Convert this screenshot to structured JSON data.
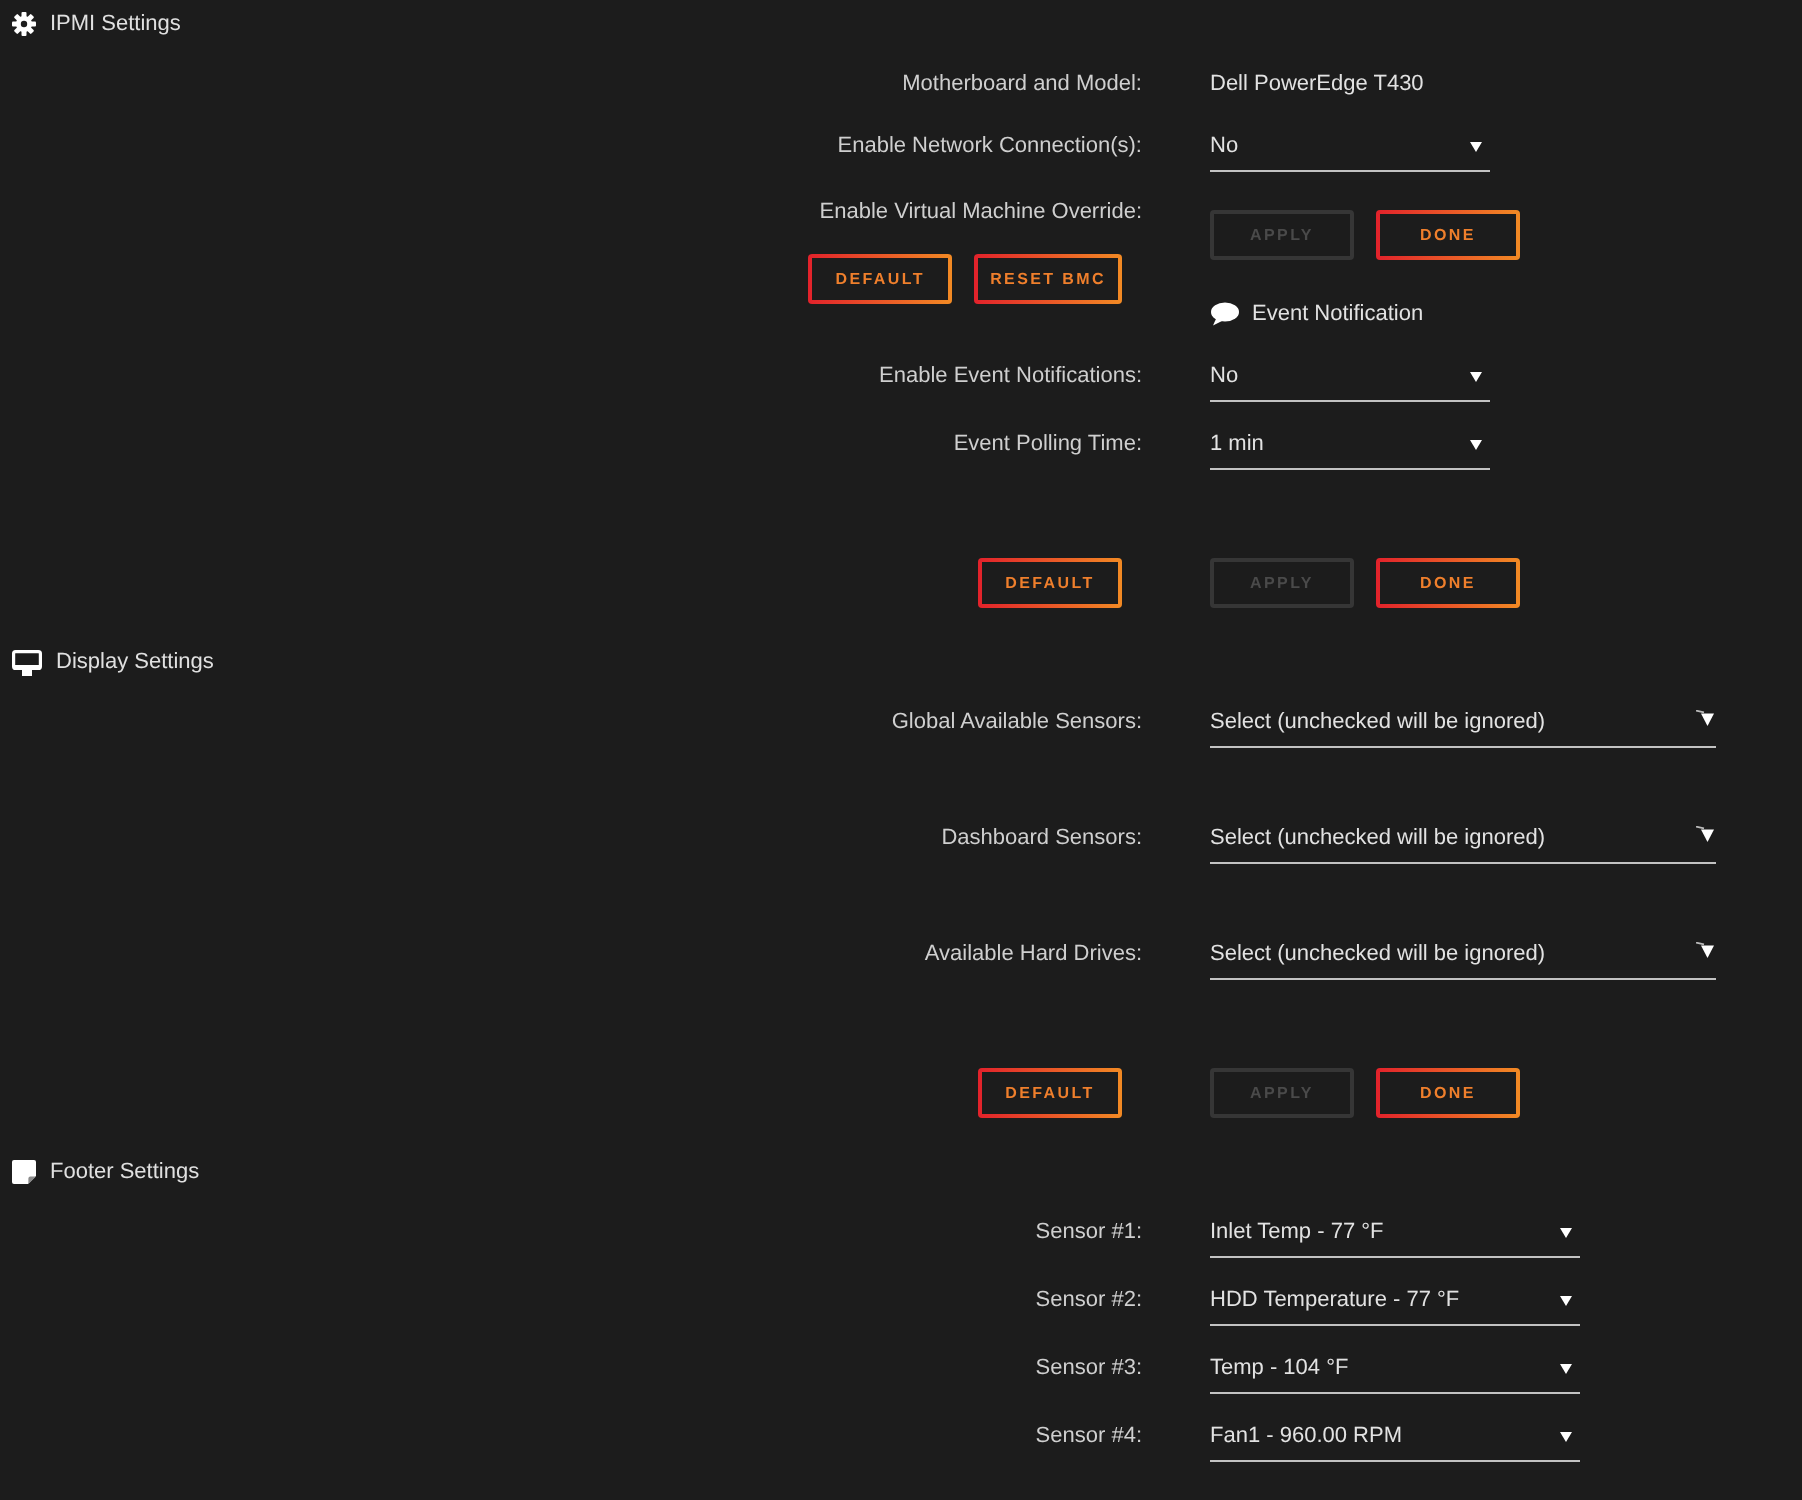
{
  "sections": [
    {
      "kind": "ipmi",
      "title": "IPMI Settings",
      "rows": [
        {
          "kind": "info",
          "label": "Motherboard and Model:",
          "value": "Dell PowerEdge T430"
        },
        {
          "kind": "select",
          "label": "Enable Network Connection(s):",
          "value": "No"
        },
        {
          "kind": "override",
          "label": "Enable Virtual Machine Override:",
          "left_buttons": [
            {
              "label": "DEFAULT",
              "disabled": false
            },
            {
              "label": "RESET BMC",
              "disabled": false
            }
          ],
          "right_buttons": [
            {
              "label": "APPLY",
              "disabled": true
            },
            {
              "label": "DONE",
              "disabled": false
            }
          ]
        },
        {
          "kind": "subheading",
          "label": "Event Notification"
        },
        {
          "kind": "select",
          "label": "Enable Event Notifications:",
          "value": "No"
        },
        {
          "kind": "select",
          "label": "Event Polling Time:",
          "value": "1 min"
        },
        {
          "kind": "buttons",
          "left_buttons": [
            {
              "label": "DEFAULT",
              "disabled": false
            }
          ],
          "right_buttons": [
            {
              "label": "APPLY",
              "disabled": true
            },
            {
              "label": "DONE",
              "disabled": false
            }
          ]
        }
      ]
    },
    {
      "kind": "display",
      "title": "Display Settings",
      "rows": [
        {
          "kind": "multiselect",
          "label": "Global Available Sensors:",
          "placeholder": "Select (unchecked will be ignored)"
        },
        {
          "kind": "multiselect",
          "label": "Dashboard Sensors:",
          "placeholder": "Select (unchecked will be ignored)"
        },
        {
          "kind": "multiselect",
          "label": "Available Hard Drives:",
          "placeholder": "Select (unchecked will be ignored)"
        },
        {
          "kind": "buttons",
          "left_buttons": [
            {
              "label": "DEFAULT",
              "disabled": false
            }
          ],
          "right_buttons": [
            {
              "label": "APPLY",
              "disabled": true
            },
            {
              "label": "DONE",
              "disabled": false
            }
          ]
        }
      ]
    },
    {
      "kind": "footer",
      "title": "Footer Settings",
      "rows": [
        {
          "kind": "select",
          "label": "Sensor #1:",
          "value": "Inlet Temp - 77 °F"
        },
        {
          "kind": "select",
          "label": "Sensor #2:",
          "value": "HDD Temperature - 77 °F"
        },
        {
          "kind": "select",
          "label": "Sensor #3:",
          "value": "Temp - 104 °F"
        },
        {
          "kind": "select",
          "label": "Sensor #4:",
          "value": "Fan1 - 960.00 RPM"
        }
      ]
    }
  ]
}
